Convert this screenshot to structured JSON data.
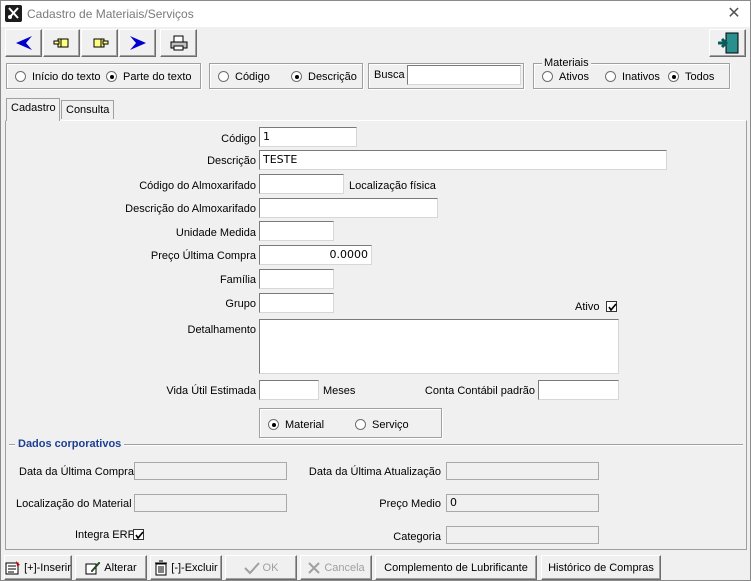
{
  "window": {
    "title": "Cadastro de Materiais/Serviços"
  },
  "search_mode": {
    "options": [
      "Início do texto",
      "Parte do texto"
    ],
    "selected": "Parte do texto"
  },
  "search_field": {
    "options": [
      "Código",
      "Descrição"
    ],
    "selected": "Descrição"
  },
  "busca": {
    "label": "Busca",
    "value": ""
  },
  "materiais_filter": {
    "title": "Materiais",
    "options": [
      "Ativos",
      "Inativos",
      "Todos"
    ],
    "selected": "Todos"
  },
  "tabs": [
    "Cadastro",
    "Consulta"
  ],
  "form": {
    "codigo": {
      "label": "Código",
      "value": "1"
    },
    "descricao": {
      "label": "Descrição",
      "value": "TESTE"
    },
    "codigo_almox": {
      "label": "Código do Almoxarifado",
      "value": ""
    },
    "localizacao_fisica": {
      "label": "Localização física"
    },
    "descricao_almox": {
      "label": "Descrição do Almoxarifado",
      "value": ""
    },
    "unidade": {
      "label": "Unidade Medida",
      "value": ""
    },
    "preco": {
      "label": "Preço Última Compra",
      "value": "0.0000"
    },
    "familia": {
      "label": "Família",
      "value": ""
    },
    "grupo": {
      "label": "Grupo",
      "value": ""
    },
    "ativo": {
      "label": "Ativo",
      "checked": true
    },
    "detalhamento": {
      "label": "Detalhamento",
      "value": ""
    },
    "vida_util": {
      "label": "Vida Útil Estimada",
      "value": "",
      "unit": "Meses"
    },
    "conta_contabil": {
      "label": "Conta Contábil padrão",
      "value": ""
    },
    "tipo": {
      "options": [
        "Material",
        "Serviço"
      ],
      "selected": "Material"
    }
  },
  "corporativo": {
    "title": "Dados corporativos",
    "data_ultima_compra": {
      "label": "Data da Última Compra",
      "value": ""
    },
    "data_ultima_atualizacao": {
      "label": "Data da Última Atualização",
      "value": ""
    },
    "localizacao_material": {
      "label": "Localização do Material",
      "value": ""
    },
    "preco_medio": {
      "label": "Preço Medio",
      "value": "0"
    },
    "integra_erp": {
      "label": "Integra ERP",
      "checked": true
    },
    "categoria": {
      "label": "Categoria",
      "value": ""
    }
  },
  "bottom_buttons": {
    "inserir": "[+]-Inserir",
    "alterar": "Alterar",
    "excluir": "[-]-Excluir",
    "ok": "OK",
    "cancela": "Cancela",
    "complemento": "Complemento de Lubrificante",
    "historico": "Histórico de Compras"
  },
  "colors": {
    "accent_blue": "#0000cc",
    "group_title": "#1c3f94"
  }
}
